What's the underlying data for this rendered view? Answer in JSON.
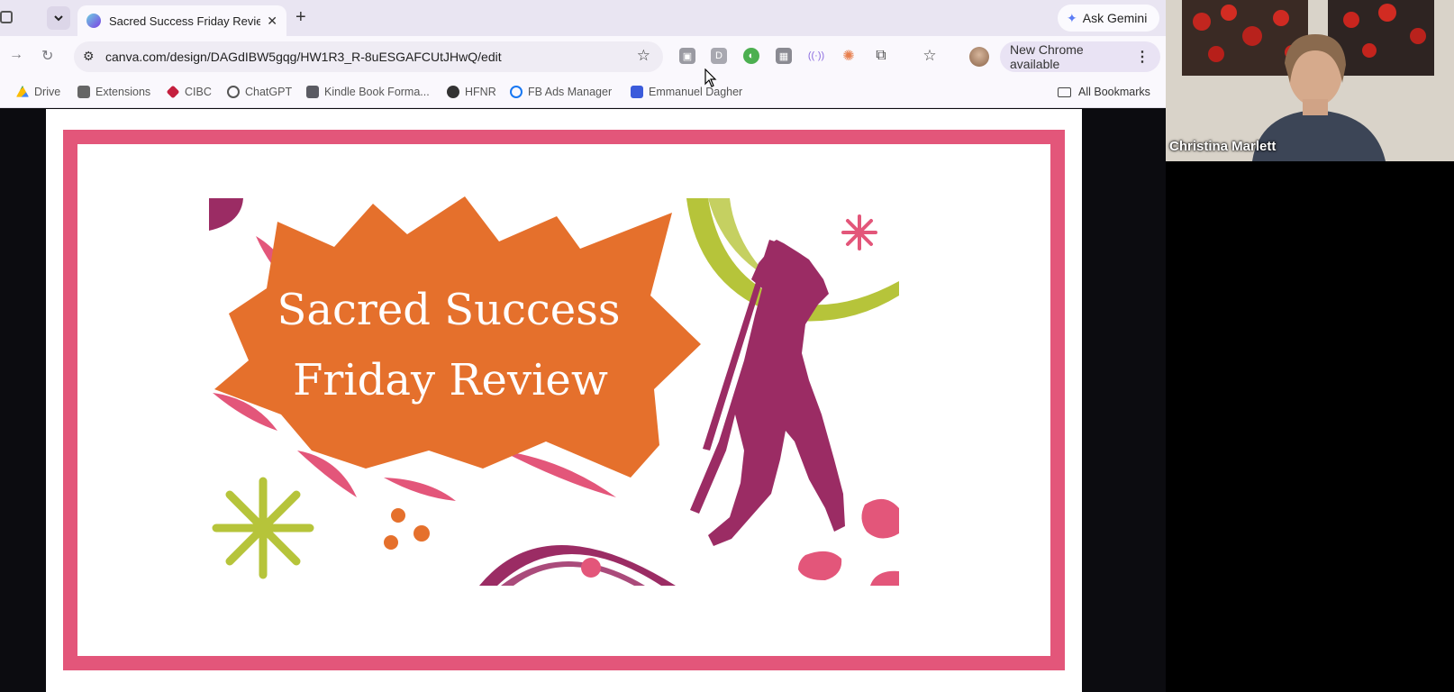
{
  "browser": {
    "tab_title": "Sacred Success Friday Review",
    "tab_close": "✕",
    "new_tab": "+",
    "ask_gemini": "Ask Gemini",
    "url": "canva.com/design/DAGdIBW5gqg/HW1R3_R-8uESGAFCUtJHwQ/edit",
    "new_chrome": "New Chrome available",
    "bookmarks": [
      "Drive",
      "Extensions",
      "CIBC",
      "ChatGPT",
      "Kindle Book Forma...",
      "HFNR",
      "FB Ads Manager",
      "Emmanuel Dagher"
    ],
    "all_bookmarks": "All Bookmarks"
  },
  "slide": {
    "title_line1": "Sacred Success",
    "title_line2": "Friday Review",
    "colors": {
      "frame": "#e3567a",
      "burst": "#e5702c",
      "magenta": "#9b2c64",
      "lime": "#b6c43a",
      "pink": "#e3567a"
    }
  },
  "participant": {
    "name": "Christina Marlett"
  }
}
